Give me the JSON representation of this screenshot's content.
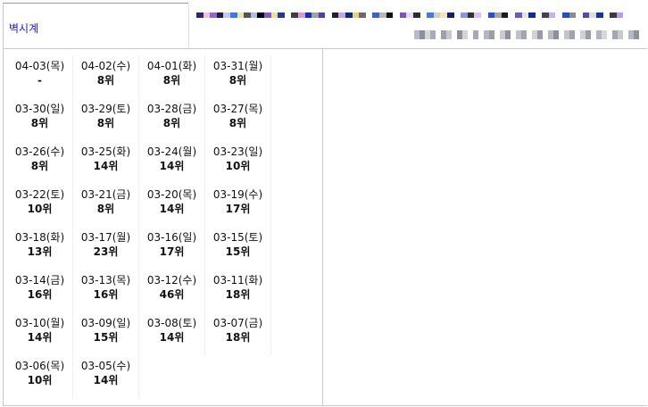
{
  "header": {
    "tab_label": "벽시계"
  },
  "redacted_strip_colors": {
    "top": [
      "#2b2b6b",
      "#f3c1d8",
      "#8a6bd6",
      "#1f1f3a",
      "#c6c8f0",
      "#3b7be0",
      "#e9e5a9",
      "#555555",
      "#b7b7e9",
      "#000000",
      "#7e5bc2",
      "#f0e0a0",
      "#243a8c",
      "#ffffff",
      "#3f3f3f",
      "#d99bd1",
      "#1230b8",
      "#a0a0a0",
      "#5a3c9e",
      "#ffffff",
      "#222222",
      "#c2a7e6",
      "#0b2a7a",
      "#e7d27a",
      "#6b6b6b",
      "#ffffff",
      "#3a62c8",
      "#b8b8b8",
      "#111111",
      "#ffffff",
      "#7a57b3",
      "#e4d9ff",
      "#2d2d2d",
      "#ffffff",
      "#4c79d8",
      "#cfcfcf",
      "#f2e5b5",
      "#1a1a6b",
      "#ffffff",
      "#8899dd",
      "#333333",
      "#e0c0f0",
      "#ffffff",
      "#2453c8",
      "#a5a5a5",
      "#1d1d1d",
      "#ffffff",
      "#6f5bb5",
      "#e3e3e3",
      "#0e2b90",
      "#ffffff",
      "#444444",
      "#c6b2ef",
      "#ffffff",
      "#244fc7",
      "#8d8d8d",
      "#ffffff",
      "#5e45a8",
      "#dcdcdc",
      "#173592",
      "#ffffff",
      "#3c3c3c",
      "#b69df0"
    ],
    "bottom": [
      "#b9bcc8",
      "#8d9098",
      "#d6d7dc",
      "#a9acb5",
      "#ffffff",
      "#9ea1aa",
      "#c7c9d0",
      "#ffffff",
      "#8e9199",
      "#d2d4da",
      "#ffffff",
      "#a7aab3",
      "#ffffff",
      "#b4b7c0",
      "#9a9da6",
      "#ffffff",
      "#c9cbd1",
      "#8f929a",
      "#ffffff",
      "#bfc2c9",
      "#a3a6ae",
      "#ffffff",
      "#d0d2d8",
      "#999ca4",
      "#ffffff",
      "#b8bbc3",
      "#8c8f97",
      "#ffffff",
      "#c2c4cb",
      "#a0a3ab",
      "#ffffff",
      "#cfd1d7",
      "#9b9ea6",
      "#ffffff",
      "#b2b5bd",
      "#d5d7dc",
      "#ffffff",
      "#a4a7af",
      "#c8cad0",
      "#ffffff",
      "#b6b9c1",
      "#8f929a"
    ]
  },
  "rankings": [
    {
      "date": "04-03(목)",
      "rank": "-"
    },
    {
      "date": "04-02(수)",
      "rank": "8위"
    },
    {
      "date": "04-01(화)",
      "rank": "8위"
    },
    {
      "date": "03-31(월)",
      "rank": "8위"
    },
    {
      "date": "03-30(일)",
      "rank": "8위"
    },
    {
      "date": "03-29(토)",
      "rank": "8위"
    },
    {
      "date": "03-28(금)",
      "rank": "8위"
    },
    {
      "date": "03-27(목)",
      "rank": "8위"
    },
    {
      "date": "03-26(수)",
      "rank": "8위"
    },
    {
      "date": "03-25(화)",
      "rank": "14위"
    },
    {
      "date": "03-24(월)",
      "rank": "14위"
    },
    {
      "date": "03-23(일)",
      "rank": "10위"
    },
    {
      "date": "03-22(토)",
      "rank": "10위"
    },
    {
      "date": "03-21(금)",
      "rank": "8위"
    },
    {
      "date": "03-20(목)",
      "rank": "14위"
    },
    {
      "date": "03-19(수)",
      "rank": "17위"
    },
    {
      "date": "03-18(화)",
      "rank": "13위"
    },
    {
      "date": "03-17(월)",
      "rank": "23위"
    },
    {
      "date": "03-16(일)",
      "rank": "17위"
    },
    {
      "date": "03-15(토)",
      "rank": "15위"
    },
    {
      "date": "03-14(금)",
      "rank": "16위"
    },
    {
      "date": "03-13(목)",
      "rank": "16위"
    },
    {
      "date": "03-12(수)",
      "rank": "46위"
    },
    {
      "date": "03-11(화)",
      "rank": "18위"
    },
    {
      "date": "03-10(월)",
      "rank": "14위"
    },
    {
      "date": "03-09(일)",
      "rank": "15위"
    },
    {
      "date": "03-08(토)",
      "rank": "14위"
    },
    {
      "date": "03-07(금)",
      "rank": "18위"
    },
    {
      "date": "03-06(목)",
      "rank": "10위"
    },
    {
      "date": "03-05(수)",
      "rank": "14위"
    }
  ]
}
